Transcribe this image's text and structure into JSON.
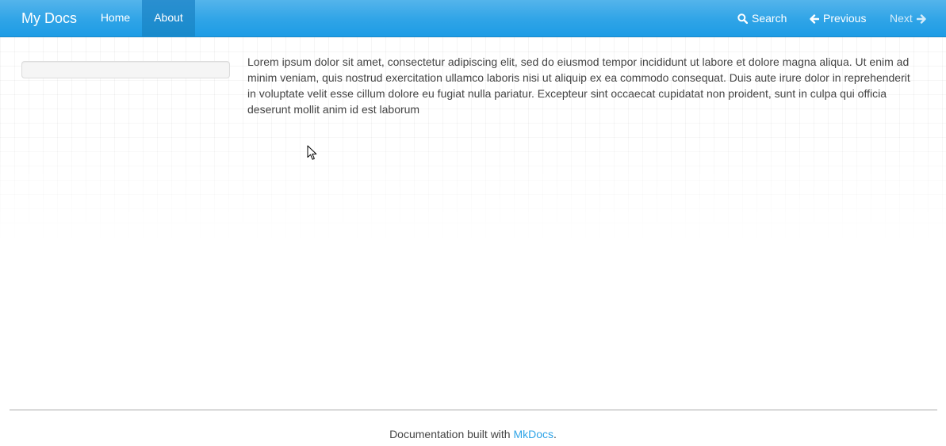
{
  "navbar": {
    "brand": "My Docs",
    "items": [
      {
        "label": "Home",
        "active": false
      },
      {
        "label": "About",
        "active": true
      }
    ],
    "search": {
      "label": "Search",
      "icon": "search-icon"
    },
    "previous": {
      "label": "Previous",
      "icon": "arrow-left-icon"
    },
    "next": {
      "label": "Next",
      "icon": "arrow-right-icon",
      "disabled": true
    },
    "colors": {
      "bar": "#2fa4e7",
      "active": "#178acc"
    }
  },
  "main": {
    "paragraph": "Lorem ipsum dolor sit amet, consectetur adipiscing elit, sed do eiusmod tempor incididunt ut labore et dolore magna aliqua. Ut enim ad minim veniam, quis nostrud exercitation ullamco laboris nisi ut aliquip ex ea commodo consequat. Duis aute irure dolor in reprehenderit in voluptate velit esse cillum dolore eu fugiat nulla pariatur. Excepteur sint occaecat cupidatat non proident, sunt in culpa qui officia deserunt mollit anim id est laborum"
  },
  "footer": {
    "text_prefix": "Documentation built with ",
    "link_label": "MkDocs",
    "text_suffix": ".",
    "link_color": "#2fa4e7"
  }
}
